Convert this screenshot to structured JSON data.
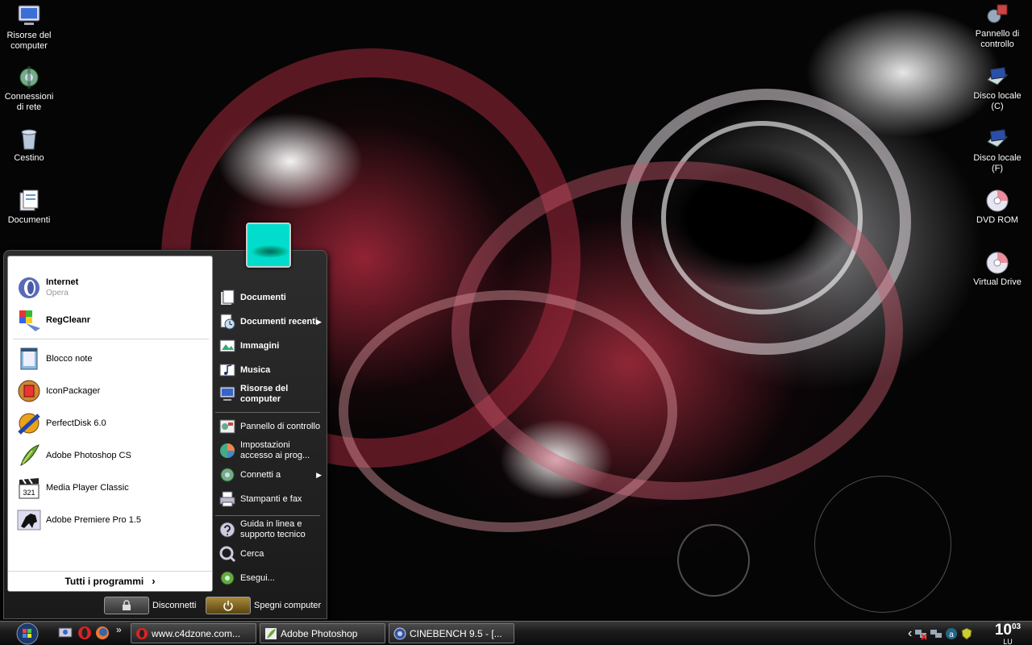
{
  "desktop": {
    "left_icons": [
      {
        "label": "Risorse del computer",
        "icon": "monitor-icon"
      },
      {
        "label": "Connessioni di rete",
        "icon": "network-icon"
      },
      {
        "label": "Cestino",
        "icon": "recycle-bin-icon"
      },
      {
        "label": "Documenti",
        "icon": "documents-folder-icon"
      }
    ],
    "right_icons": [
      {
        "label": "Pannello di controllo",
        "icon": "control-panel-icon"
      },
      {
        "label": "Disco locale (C)",
        "icon": "hard-drive-icon"
      },
      {
        "label": "Disco locale (F)",
        "icon": "hard-drive-icon"
      },
      {
        "label": "DVD ROM",
        "icon": "disc-icon"
      },
      {
        "label": "Virtual Drive",
        "icon": "disc-icon"
      }
    ]
  },
  "start_menu": {
    "pinned": [
      {
        "title": "Internet",
        "subtitle": "Opera",
        "icon": "opera-icon"
      },
      {
        "title": "RegCleanr",
        "icon": "regcleanr-icon"
      }
    ],
    "recent": [
      {
        "label": "Blocco note",
        "icon": "notepad-icon"
      },
      {
        "label": "IconPackager",
        "icon": "iconpackager-icon"
      },
      {
        "label": "PerfectDisk 6.0",
        "icon": "perfectdisk-icon"
      },
      {
        "label": "Adobe Photoshop CS",
        "icon": "photoshop-icon"
      },
      {
        "label": "Media Player Classic",
        "icon": "media-player-icon"
      },
      {
        "label": "Adobe Premiere Pro 1.5",
        "icon": "premiere-icon"
      }
    ],
    "all_programs": "Tutti i programmi",
    "right_items": [
      {
        "label": "Documenti",
        "bold": true,
        "icon": "documents-icon"
      },
      {
        "label": "Documenti recenti",
        "bold": true,
        "icon": "recent-documents-icon",
        "submenu": true
      },
      {
        "label": "Immagini",
        "bold": true,
        "icon": "pictures-icon"
      },
      {
        "label": "Musica",
        "bold": true,
        "icon": "music-icon"
      },
      {
        "label": "Risorse del computer",
        "bold": true,
        "icon": "computer-icon"
      },
      {
        "label": "Pannello di controllo",
        "bold": false,
        "icon": "control-panel-icon"
      },
      {
        "label": "Impostazioni accesso ai prog...",
        "bold": false,
        "icon": "program-access-icon"
      },
      {
        "label": "Connetti a",
        "bold": false,
        "icon": "connect-icon",
        "submenu": true
      },
      {
        "label": "Stampanti e fax",
        "bold": false,
        "icon": "printer-icon"
      },
      {
        "label": "Guida in linea e supporto tecnico",
        "bold": false,
        "icon": "help-icon"
      },
      {
        "label": "Cerca",
        "bold": false,
        "icon": "search-icon"
      },
      {
        "label": "Esegui...",
        "bold": false,
        "icon": "run-icon"
      }
    ],
    "logoff": "Disconnetti",
    "shutdown": "Spegni computer"
  },
  "taskbar": {
    "quick_launch_more": "»",
    "tasks": [
      {
        "label": "www.c4dzone.com...",
        "icon": "opera-icon"
      },
      {
        "label": "Adobe Photoshop",
        "icon": "photoshop-icon"
      },
      {
        "label": "CINEBENCH 9.5 - [...",
        "icon": "cinebench-icon"
      }
    ],
    "tray_expand": "‹",
    "clock_hour": "10",
    "clock_min": "03",
    "clock_day": "LU"
  }
}
